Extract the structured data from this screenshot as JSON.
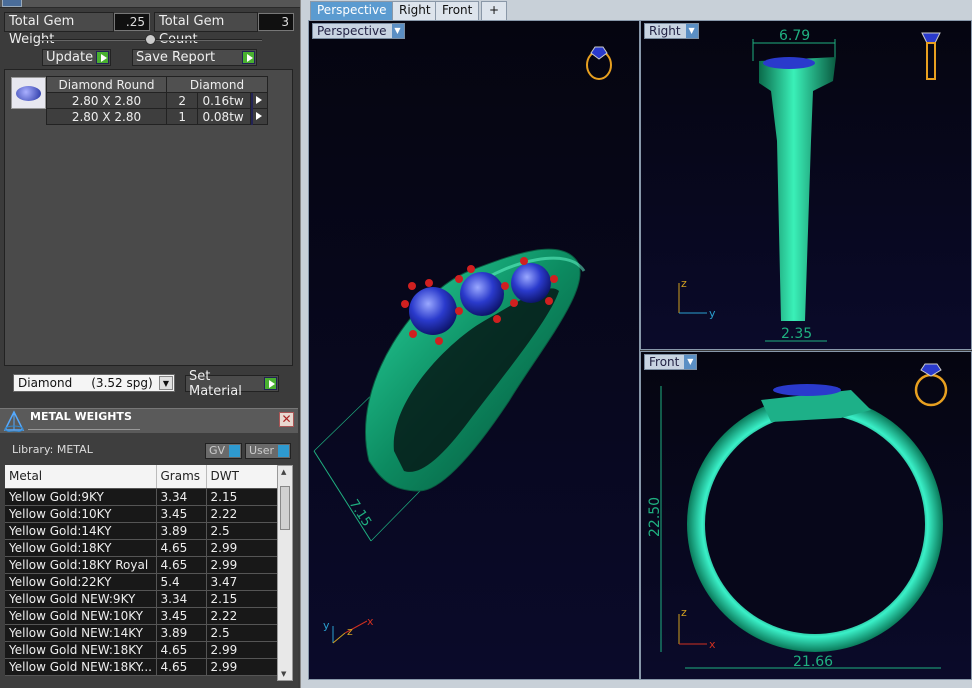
{
  "gem_weight": {
    "label": "Total Gem Weight",
    "value": ".25"
  },
  "gem_count": {
    "label": "Total Gem Count",
    "value": "3"
  },
  "buttons": {
    "update": "Update",
    "save_report": "Save Report",
    "set_material": "Set Material"
  },
  "gem_table": {
    "headers": [
      "Diamond Round",
      "Diamond"
    ],
    "rows": [
      {
        "size": "2.80 X 2.80",
        "count": "2",
        "weight": "0.16tw"
      },
      {
        "size": "2.80 X 2.80",
        "count": "1",
        "weight": "0.08tw"
      }
    ]
  },
  "material_select": {
    "value": "Diamond     (3.52 spg)"
  },
  "metal_weights": {
    "title": "METAL WEIGHTS",
    "library": "Library: METAL",
    "toggle_gv": "GV",
    "toggle_user": "User",
    "headers": [
      "Metal",
      "Grams",
      "DWT"
    ],
    "rows": [
      [
        "Yellow Gold:9KY",
        "3.34",
        "2.15"
      ],
      [
        "Yellow Gold:10KY",
        "3.45",
        "2.22"
      ],
      [
        "Yellow Gold:14KY",
        "3.89",
        "2.5"
      ],
      [
        "Yellow Gold:18KY",
        "4.65",
        "2.99"
      ],
      [
        "Yellow Gold:18KY Royal",
        "4.65",
        "2.99"
      ],
      [
        "Yellow Gold:22KY",
        "5.4",
        "3.47"
      ],
      [
        "Yellow Gold NEW:9KY",
        "3.34",
        "2.15"
      ],
      [
        "Yellow Gold NEW:10KY",
        "3.45",
        "2.22"
      ],
      [
        "Yellow Gold NEW:14KY",
        "3.89",
        "2.5"
      ],
      [
        "Yellow Gold NEW:18KY",
        "4.65",
        "2.99"
      ],
      [
        "Yellow Gold NEW:18KY...",
        "4.65",
        "2.99"
      ]
    ]
  },
  "tabs": [
    "Perspective",
    "Right",
    "Front",
    "+"
  ],
  "viewports": {
    "perspective": {
      "label": "Perspective",
      "dim": "7.15"
    },
    "right": {
      "label": "Right",
      "dim_top": "6.79",
      "dim_bottom": "2.35"
    },
    "front": {
      "label": "Front",
      "dim_height": "22.50",
      "dim_width": "21.66"
    }
  },
  "axes": {
    "x": "x",
    "y": "y",
    "z": "z"
  },
  "colors": {
    "metal": "#1fb080",
    "gem": "#2a3acc",
    "prong": "#cc2020",
    "viewport_bg": "#080820",
    "accent_green": "#49b030"
  }
}
